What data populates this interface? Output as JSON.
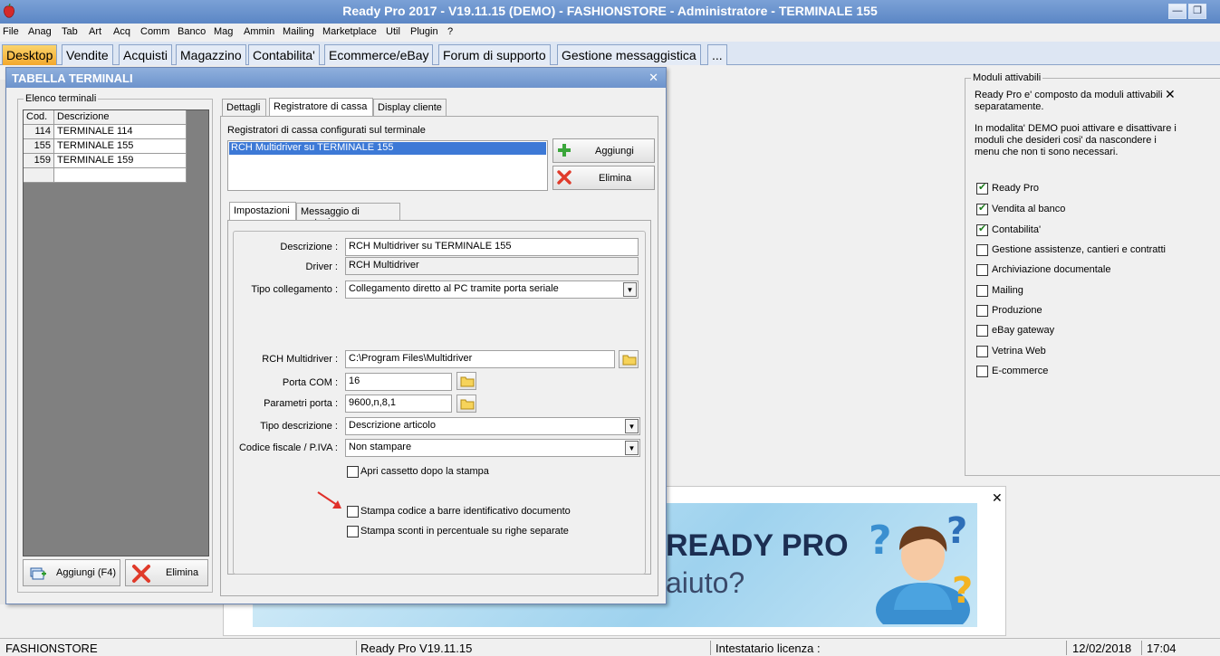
{
  "window": {
    "title": "Ready Pro 2017 - V19.11.15 (DEMO) - FASHIONSTORE - Administratore - TERMINALE 155"
  },
  "menu": [
    "File",
    "Anag",
    "Tab",
    "Art",
    "Acq",
    "Comm",
    "Banco",
    "Mag",
    "Ammin",
    "Mailing",
    "Marketplace",
    "Util",
    "Plugin",
    "?"
  ],
  "tabs": [
    "Desktop",
    "Vendite",
    "Acquisti",
    "Magazzino",
    "Contabilita'",
    "Ecommerce/eBay",
    "Forum di supporto",
    "Gestione messaggistica",
    "..."
  ],
  "dialog": {
    "title": "TABELLA TERMINALI",
    "elenco_label": "Elenco terminali",
    "grid": {
      "headers": [
        "Cod.",
        "Descrizione"
      ],
      "rows": [
        {
          "cod": "114",
          "desc": "TERMINALE 114"
        },
        {
          "cod": "155",
          "desc": "TERMINALE 155"
        },
        {
          "cod": "159",
          "desc": "TERMINALE 159"
        }
      ]
    },
    "add_button": "Aggiungi (F4)",
    "delete_button": "Elimina",
    "tabs": [
      "Dettagli",
      "Registratore di cassa",
      "Display cliente"
    ],
    "registratori_label": "Registratori di cassa configurati sul terminale",
    "registratori_list": [
      "RCH Multidriver su TERMINALE 155"
    ],
    "reg_add_button": "Aggiungi",
    "reg_delete_button": "Elimina",
    "subtabs": [
      "Impostazioni",
      "Messaggio di cortesia"
    ],
    "fields": {
      "descrizione_label": "Descrizione :",
      "descrizione_value": "RCH Multidriver su TERMINALE 155",
      "driver_label": "Driver :",
      "driver_value": "RCH Multidriver",
      "tipo_coll_label": "Tipo collegamento :",
      "tipo_coll_value": "Collegamento diretto al PC tramite porta seriale",
      "rch_label": "RCH Multidriver :",
      "rch_value": "C:\\Program Files\\Multidriver",
      "porta_label": "Porta COM :",
      "porta_value": "16",
      "parametri_label": "Parametri porta :",
      "parametri_value": "9600,n,8,1",
      "tipo_desc_label": "Tipo descrizione :",
      "tipo_desc_value": "Descrizione articolo",
      "codice_label": "Codice fiscale / P.IVA :",
      "codice_value": "Non stampare",
      "apri_cassetto": "Apri cassetto dopo la stampa",
      "stampa_barre": "Stampa codice a barre identificativo documento",
      "stampa_sconti": "Stampa sconti in percentuale su righe separate"
    }
  },
  "moduli": {
    "legend": "Moduli attivabili",
    "info1": "Ready Pro e' composto da moduli attivabili separatamente.",
    "info2": "In modalita' DEMO puoi attivare e disattivare i moduli che desideri cosi' da nascondere i menu che non ti sono necessari.",
    "items": [
      {
        "label": "Ready Pro",
        "checked": true
      },
      {
        "label": "Vendita al banco",
        "checked": true
      },
      {
        "label": "Contabilita'",
        "checked": true
      },
      {
        "label": "Gestione assistenze, cantieri e contratti",
        "checked": false
      },
      {
        "label": "Archiviazione documentale",
        "checked": false
      },
      {
        "label": "Mailing",
        "checked": false
      },
      {
        "label": "Produzione",
        "checked": false
      },
      {
        "label": "eBay gateway",
        "checked": false
      },
      {
        "label": "Vetrina Web",
        "checked": false
      },
      {
        "label": "E-commerce",
        "checked": false
      }
    ]
  },
  "banner": {
    "line1": "READY PRO",
    "line2": "aiuto?"
  },
  "status": {
    "company": "FASHIONSTORE",
    "version": "Ready Pro V19.11.15",
    "license": "Intestatario licenza :",
    "date": "12/02/2018",
    "time": "17:04"
  },
  "colors": {
    "accent_tab": "#f3a82d",
    "titlebar": "#5b86c5",
    "check": "#1e7d1e",
    "delete_x": "#e03a2a",
    "add_plus": "#3aa63a"
  }
}
